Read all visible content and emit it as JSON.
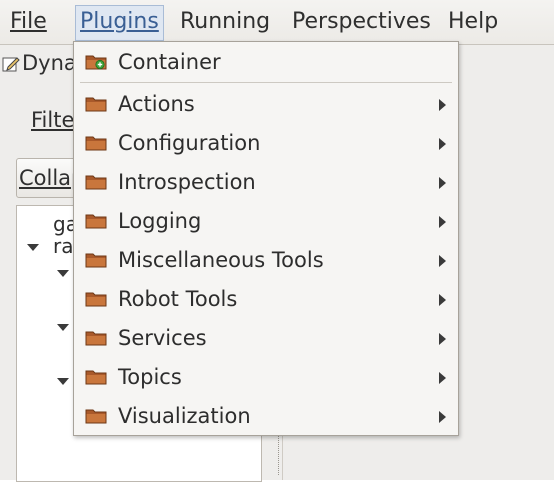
{
  "menubar": {
    "items": [
      {
        "label": "File"
      },
      {
        "label": "Plugins"
      },
      {
        "label": "Running"
      },
      {
        "label": "Perspectives"
      },
      {
        "label": "Help"
      }
    ]
  },
  "background": {
    "plugin_tab": "Dyna",
    "filter_label": "Filte",
    "collapse_label": "Collap",
    "tree_lines": [
      "ga",
      "ra"
    ]
  },
  "plugins_menu": {
    "header_item": {
      "label": "Container",
      "icon": "folder-add-icon"
    },
    "items": [
      {
        "label": "Actions",
        "icon": "folder-icon",
        "has_submenu": true
      },
      {
        "label": "Configuration",
        "icon": "folder-icon",
        "has_submenu": true
      },
      {
        "label": "Introspection",
        "icon": "folder-icon",
        "has_submenu": true
      },
      {
        "label": "Logging",
        "icon": "folder-icon",
        "has_submenu": true
      },
      {
        "label": "Miscellaneous Tools",
        "icon": "folder-icon",
        "has_submenu": true
      },
      {
        "label": "Robot Tools",
        "icon": "folder-icon",
        "has_submenu": true
      },
      {
        "label": "Services",
        "icon": "folder-icon",
        "has_submenu": true
      },
      {
        "label": "Topics",
        "icon": "folder-icon",
        "has_submenu": true
      },
      {
        "label": "Visualization",
        "icon": "folder-icon",
        "has_submenu": true
      }
    ]
  },
  "colors": {
    "menubar_active_bg": "#dfe7f2",
    "menubar_active_text": "#3a5f94",
    "folder_fill": "#b5652d",
    "add_badge": "#3fa53c"
  }
}
